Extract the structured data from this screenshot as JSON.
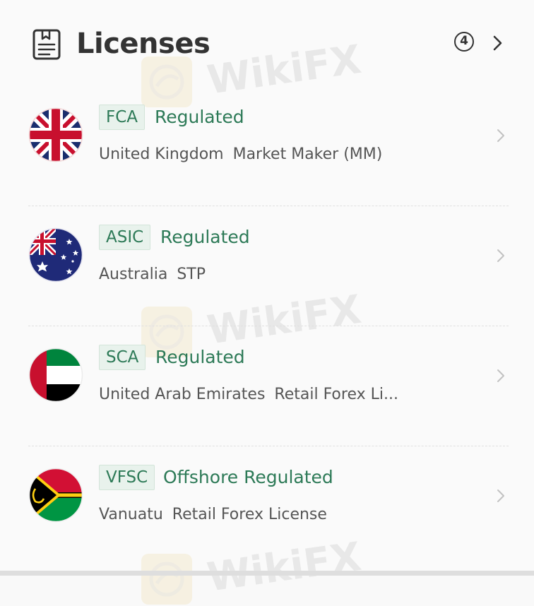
{
  "header": {
    "title": "Licenses",
    "count": "4",
    "icon": "document-icon",
    "chevron_icon": "chevron-right-icon"
  },
  "watermark": {
    "text": "WikiFX"
  },
  "licenses": [
    {
      "code": "FCA",
      "status": "Regulated",
      "country": "United Kingdom",
      "type": "Market Maker (MM)",
      "flag": "uk-flag-icon"
    },
    {
      "code": "ASIC",
      "status": "Regulated",
      "country": "Australia",
      "type": "STP",
      "flag": "australia-flag-icon"
    },
    {
      "code": "SCA",
      "status": "Regulated",
      "country": "United Arab Emirates",
      "type": "Retail Forex Li...",
      "flag": "uae-flag-icon"
    },
    {
      "code": "VFSC",
      "status": "Offshore Regulated",
      "country": "Vanuatu",
      "type": "Retail Forex License",
      "flag": "vanuatu-flag-icon"
    }
  ],
  "colors": {
    "accent_green": "#2d7a57",
    "badge_background": "#e8f2ec",
    "text_primary": "#333333",
    "text_secondary": "#555555"
  }
}
